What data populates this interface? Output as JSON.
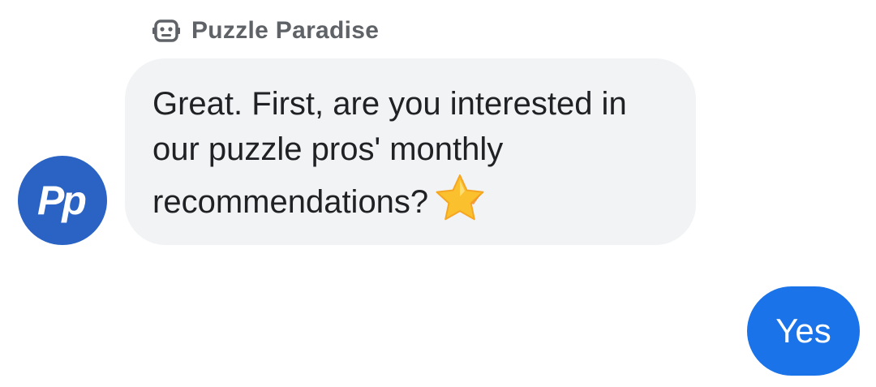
{
  "sender": {
    "name": "Puzzle Paradise",
    "icon": "bot-icon"
  },
  "avatar": {
    "initials": "Pp",
    "color": "#2a63c4"
  },
  "message": {
    "text": "Great. First, are you interested in our puzzle pros' monthly recommendations?",
    "emoji": "star-icon"
  },
  "reply": {
    "label": "Yes",
    "color": "#1a73e8"
  },
  "colors": {
    "bubble_background": "#f1f3f4",
    "sender_text": "#5f6368",
    "message_text": "#202124"
  }
}
